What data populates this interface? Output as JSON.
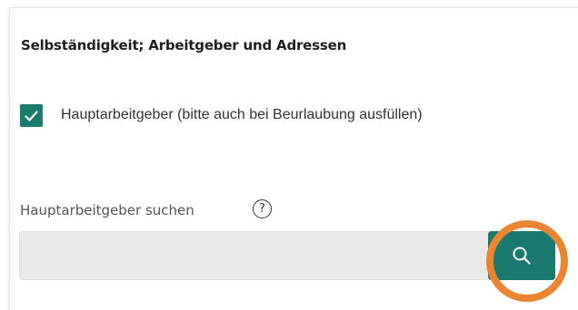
{
  "section": {
    "title": "Selbständigkeit; Arbeitgeber und Adressen"
  },
  "checkbox": {
    "label": "Hauptarbeitgeber (bitte auch bei Beurlaubung ausfüllen)",
    "checked": true,
    "icon": "check-icon"
  },
  "search": {
    "label": "Hauptarbeitgeber suchen",
    "help_icon": "?",
    "value": "",
    "placeholder": "",
    "button_icon": "search-icon"
  },
  "colors": {
    "accent": "#1b7a6e",
    "highlight": "#ea8531",
    "input_bg": "#e9e9e9"
  }
}
